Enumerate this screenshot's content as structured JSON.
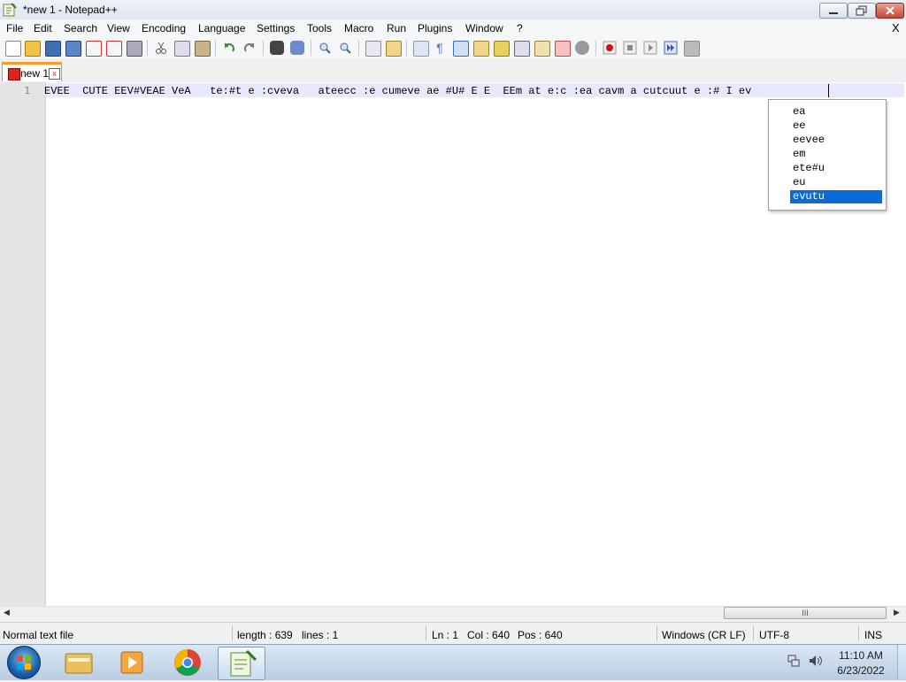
{
  "window": {
    "title": "*new 1 - Notepad++"
  },
  "menu": {
    "items": [
      "File",
      "Edit",
      "Search",
      "View",
      "Encoding",
      "Language",
      "Settings",
      "Tools",
      "Macro",
      "Run",
      "Plugins",
      "Window",
      "?"
    ],
    "close_doc": "X"
  },
  "toolbar": {
    "icons": [
      "new-file-icon",
      "open-file-icon",
      "save-icon",
      "save-all-icon",
      "close-icon",
      "close-all-icon",
      "print-icon",
      "cut-icon",
      "copy-icon",
      "paste-icon",
      "undo-icon",
      "redo-icon",
      "find-icon",
      "replace-icon",
      "zoom-in-icon",
      "zoom-out-icon",
      "sync-vertical-icon",
      "sync-horizontal-icon",
      "word-wrap-icon",
      "show-all-chars-icon",
      "indent-guide-icon",
      "doc-map-icon",
      "function-list-icon",
      "folder-workspace-icon",
      "monitoring-icon",
      "doc-switcher-icon",
      "lang-icon",
      "record-macro-icon",
      "stop-record-icon",
      "play-macro-icon",
      "run-macro-multiple-icon",
      "save-macro-icon"
    ]
  },
  "tabs": [
    {
      "label": "new 1",
      "close": "x"
    }
  ],
  "editor": {
    "line_number": "1",
    "line_text": "EVEE  CUTE EEV#VEAE VeA   te:#t e :cveva   ateecc :e cumeve ae #U# E E  EEm at e:c :ea cavm a cutcuut e :# I ev"
  },
  "autocomplete": {
    "items": [
      "ea",
      "ee",
      "eevee",
      "em",
      "ete#u",
      "eu",
      "evutu"
    ],
    "selected": "evutu",
    "selected_color": "#0a6ad8"
  },
  "scrollbar": {
    "thumb_grip": "III"
  },
  "status": {
    "file_type": "Normal text file",
    "length": "length : 639",
    "lines": "lines : 1",
    "ln": "Ln : 1",
    "col": "Col : 640",
    "pos": "Pos : 640",
    "eol": "Windows (CR LF)",
    "encoding": "UTF-8",
    "mode": "INS"
  },
  "taskbar": {
    "apps": [
      "windows-explorer-icon",
      "media-player-icon",
      "chrome-icon",
      "notepad-plus-plus-icon"
    ],
    "time": "11:10 AM",
    "date": "6/23/2022"
  }
}
